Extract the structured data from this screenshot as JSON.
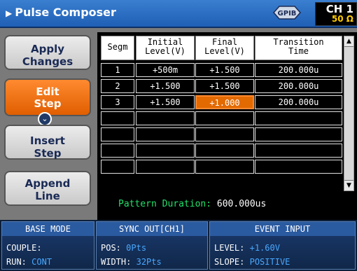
{
  "window": {
    "title": "Pulse Composer",
    "channel": "CH 1",
    "impedance": "50 Ω",
    "gpib_label": "GPIB"
  },
  "buttons": [
    {
      "line1": "Apply",
      "line2": "Changes"
    },
    {
      "line1": "Edit",
      "line2": "Step"
    },
    {
      "line1": "Insert",
      "line2": "Step"
    },
    {
      "line1": "Append",
      "line2": "Line"
    }
  ],
  "table": {
    "headers": [
      {
        "line1": "Segm",
        "line2": ""
      },
      {
        "line1": "Initial",
        "line2": "Level(V)"
      },
      {
        "line1": "Final",
        "line2": "Level(V)"
      },
      {
        "line1": "Transition",
        "line2": "Time"
      }
    ],
    "rows": [
      [
        "1",
        "+500m",
        "+1.500",
        "200.000u"
      ],
      [
        "2",
        "+1.500",
        "+1.500",
        "200.000u"
      ],
      [
        "3",
        "+1.500",
        "+1.000",
        "200.000u"
      ],
      [
        "",
        "",
        "",
        ""
      ],
      [
        "",
        "",
        "",
        ""
      ],
      [
        "",
        "",
        "",
        ""
      ],
      [
        "",
        "",
        "",
        ""
      ]
    ]
  },
  "duration": {
    "label": "Pattern Duration:",
    "value": "600.000us"
  },
  "status": {
    "base_mode": {
      "header": "BASE MODE",
      "couple_label": "COUPLE:",
      "couple_value": "",
      "run_label": "RUN:",
      "run_value": "CONT"
    },
    "sync_out": {
      "header": "SYNC OUT[CH1]",
      "pos_label": "POS:",
      "pos_value": "0Pts",
      "width_label": "WIDTH:",
      "width_value": "32Pts"
    },
    "event_input": {
      "header": "EVENT INPUT",
      "level_label": "LEVEL:",
      "level_value": "+1.60V",
      "slope_label": "SLOPE:",
      "slope_value": "POSITIVE"
    }
  },
  "icons": {
    "title_arrow": "play-arrow-icon",
    "edit_toggle": "chevron-down-icon"
  }
}
